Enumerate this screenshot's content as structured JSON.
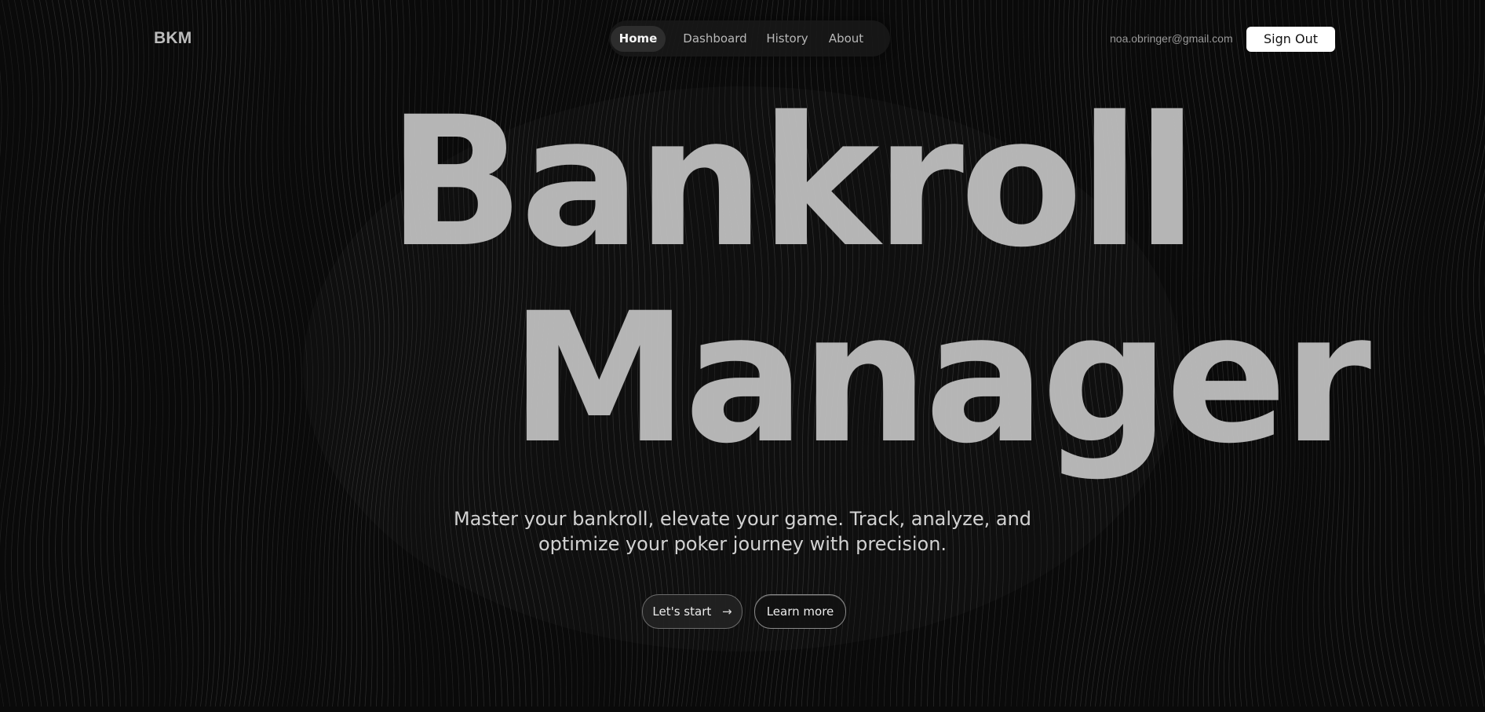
{
  "header": {
    "logo": "BKM",
    "nav": {
      "items": [
        {
          "label": "Home",
          "active": true
        },
        {
          "label": "Dashboard",
          "active": false
        },
        {
          "label": "History",
          "active": false
        },
        {
          "label": "About",
          "active": false
        }
      ]
    },
    "user_email": "noa.obringer@gmail.com",
    "sign_out_label": "Sign Out"
  },
  "hero": {
    "title_line_1": "Bankroll",
    "title_line_2": "Manager",
    "tagline_line_1": "Master your bankroll, elevate your game. Track, analyze, and",
    "tagline_line_2": "optimize your poker journey with precision.",
    "buttons": {
      "start_label": "Let's start",
      "learn_more_label": "Learn more"
    }
  },
  "icons": {
    "start_button_icon": "arrow-right-icon"
  },
  "colors": {
    "background": "#0a0a0a",
    "nav_background": "#181818",
    "active_nav": "#2d2d2d",
    "hero_text": "#bcbcbc",
    "button_light": "#ffffff"
  }
}
